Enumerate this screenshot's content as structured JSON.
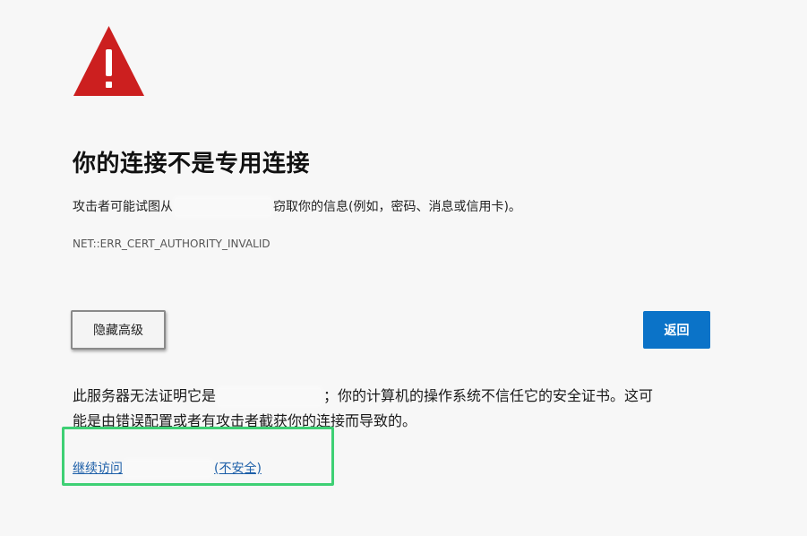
{
  "icons": {
    "warning": "warning-triangle-icon"
  },
  "colors": {
    "warning_red": "#cc1f1f",
    "primary_blue": "#0b73c8",
    "link_blue": "#1d5fa8",
    "highlight_green": "#3ed074"
  },
  "header": {
    "title": "你的连接不是专用连接"
  },
  "intro": {
    "prefix": "攻击者可能试图从",
    "suffix": "窃取你的信息(例如，密码、消息或信用卡)。"
  },
  "error_code": "NET::ERR_CERT_AUTHORITY_INVALID",
  "buttons": {
    "advanced_label": "隐藏高级",
    "back_label": "返回"
  },
  "details": {
    "line1_prefix": "此服务器无法证明它是",
    "line1_suffix": "；你的计算机的操作系统不信任它的安全证书。这可",
    "line2": "能是由错误配置或者有攻击者截获你的连接而导致的。"
  },
  "proceed": {
    "prefix": "继续访问",
    "suffix": "(不安全)"
  }
}
